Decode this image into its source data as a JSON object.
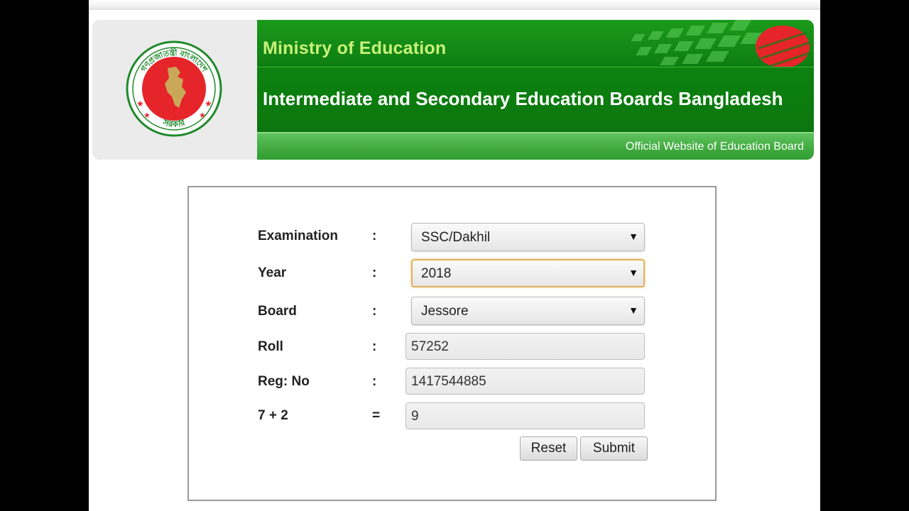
{
  "header": {
    "ministry": "Ministry of Education",
    "board_title": "Intermediate and Secondary Education Boards Bangladesh",
    "tagline": "Official Website of Education Board",
    "logo_text_top": "গণপ্রজাতন্ত্রী বাংলাদেশ",
    "logo_text_bottom": "সরকার"
  },
  "form": {
    "examination": {
      "label": "Examination",
      "sep": ":",
      "value": "SSC/Dakhil"
    },
    "year": {
      "label": "Year",
      "sep": ":",
      "value": "2018"
    },
    "board": {
      "label": "Board",
      "sep": ":",
      "value": "Jessore"
    },
    "roll": {
      "label": "Roll",
      "sep": ":",
      "value": "57252"
    },
    "reg_no": {
      "label": "Reg: No",
      "sep": ":",
      "value": "1417544885"
    },
    "captcha": {
      "label": "7 + 2",
      "sep": "=",
      "value": "9"
    },
    "reset_label": "Reset",
    "submit_label": "Submit"
  },
  "colors": {
    "banner_green": "#0e7d12",
    "ministry_text": "#c9f27a",
    "flag_red": "#e5252a",
    "focus_border": "#e0b15a"
  },
  "icons": {
    "arrow": "▼"
  }
}
